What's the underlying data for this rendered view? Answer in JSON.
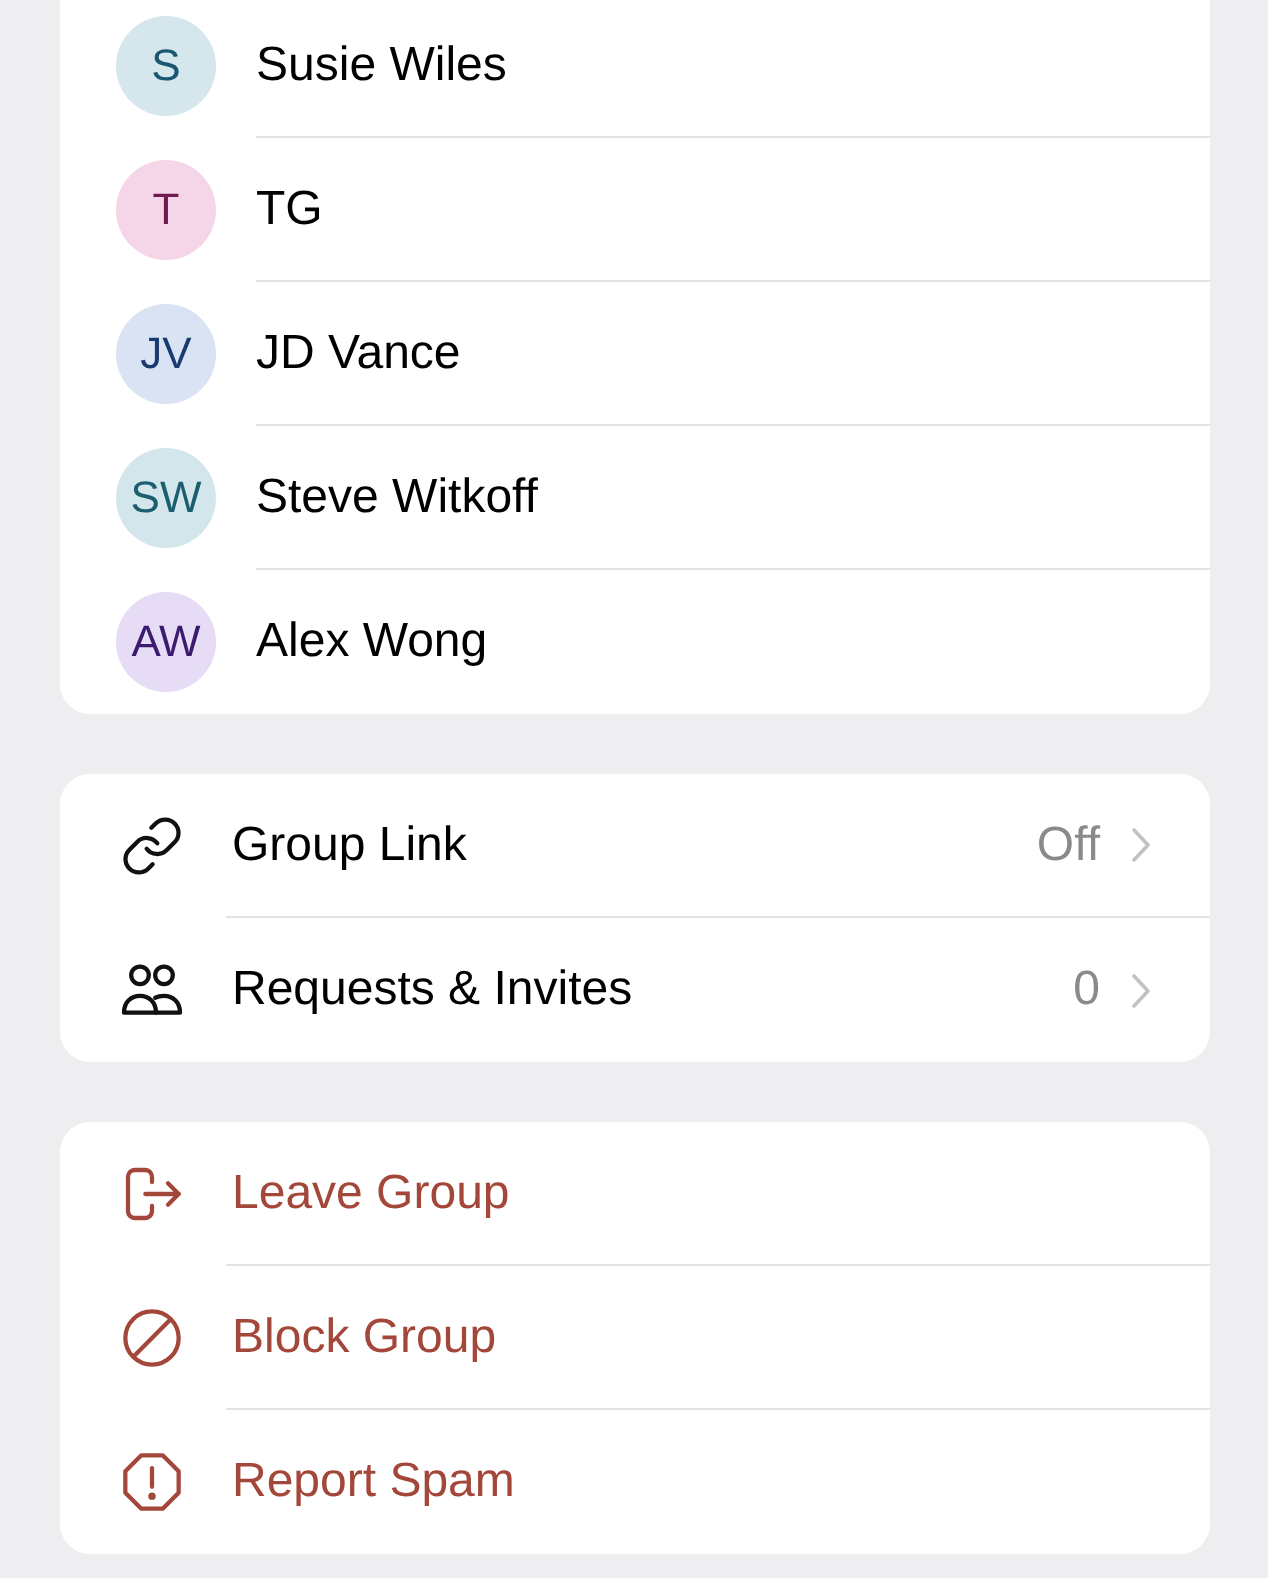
{
  "members": [
    {
      "initials": "S",
      "name": "Susie Wiles",
      "color": "#d5e6ed"
    },
    {
      "initials": "T",
      "name": "TG",
      "color": "#f4d6e8"
    },
    {
      "initials": "JV",
      "name": "JD Vance",
      "color": "#d9e3f3"
    },
    {
      "initials": "SW",
      "name": "Steve Witkoff",
      "color": "#d3e6eb"
    },
    {
      "initials": "AW",
      "name": "Alex Wong",
      "color": "#e6dcf5"
    }
  ],
  "settings": [
    {
      "kind": "link",
      "label": "Group Link",
      "value": "Off"
    },
    {
      "kind": "requests",
      "label": "Requests & Invites",
      "value": "0"
    }
  ],
  "actions": [
    {
      "kind": "leave",
      "label": "Leave Group"
    },
    {
      "kind": "block",
      "label": "Block Group"
    },
    {
      "kind": "report",
      "label": "Report Spam"
    }
  ]
}
